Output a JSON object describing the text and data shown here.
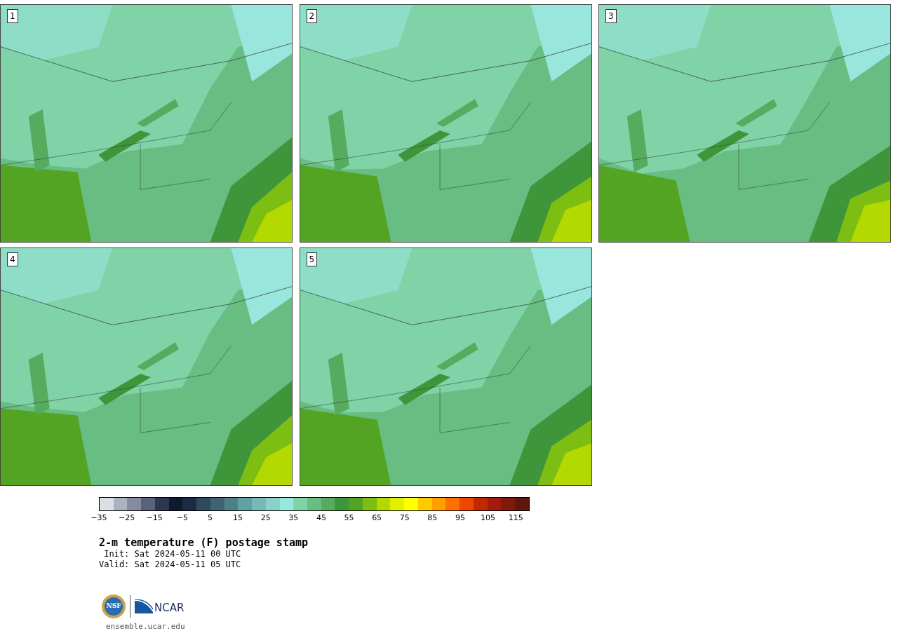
{
  "maps": [
    {
      "label": "1"
    },
    {
      "label": "2"
    },
    {
      "label": "3"
    },
    {
      "label": "4"
    },
    {
      "label": "5"
    }
  ],
  "colorbar": {
    "swatches": [
      {
        "color": "#dcdfe6"
      },
      {
        "color": "#adb2c1"
      },
      {
        "color": "#858c9f"
      },
      {
        "color": "#5a627b"
      },
      {
        "color": "#2d3550"
      },
      {
        "color": "#0f1a30"
      },
      {
        "color": "#1c2b45"
      },
      {
        "color": "#2e4b5c"
      },
      {
        "color": "#3e6472"
      },
      {
        "color": "#4e8085"
      },
      {
        "color": "#61a0a5"
      },
      {
        "color": "#77b9b7"
      },
      {
        "color": "#8ad1c9"
      },
      {
        "color": "#98e6dc"
      },
      {
        "color": "#7fd3a7"
      },
      {
        "color": "#67bd82"
      },
      {
        "color": "#56ab5f"
      },
      {
        "color": "#3f963a"
      },
      {
        "color": "#54a423"
      },
      {
        "color": "#7dbe12"
      },
      {
        "color": "#b4d900"
      },
      {
        "color": "#e2f000"
      },
      {
        "color": "#ffff00"
      },
      {
        "color": "#ffca00"
      },
      {
        "color": "#ff9e00"
      },
      {
        "color": "#ff7000"
      },
      {
        "color": "#ee4800"
      },
      {
        "color": "#c32900"
      },
      {
        "color": "#a11c0a"
      },
      {
        "color": "#7e190c"
      },
      {
        "color": "#5e170e"
      }
    ],
    "tick_labels": [
      "−35",
      "−25",
      "−15",
      "−5",
      "5",
      "15",
      "25",
      "35",
      "45",
      "55",
      "65",
      "75",
      "85",
      "95",
      "105",
      "115"
    ]
  },
  "title": "2-m temperature (F) postage stamp",
  "init": " Init: Sat 2024-05-11 00 UTC",
  "valid": "Valid: Sat 2024-05-11 05 UTC",
  "logo": {
    "left": "NSF",
    "right": "NCAR"
  },
  "url": "ensemble.ucar.edu"
}
